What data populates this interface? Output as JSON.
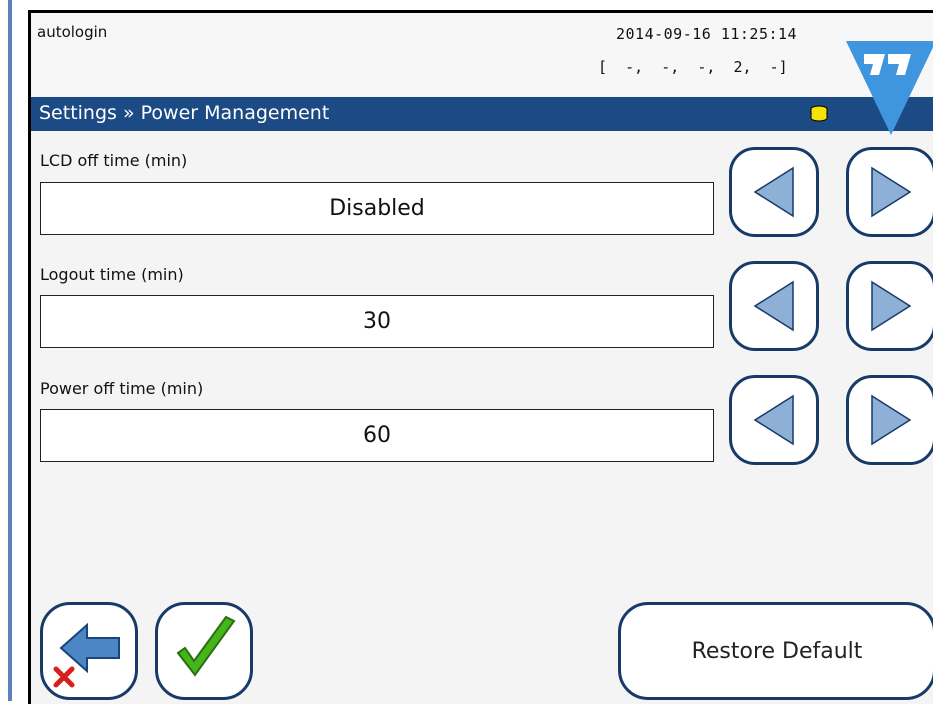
{
  "header": {
    "user": "autologin",
    "datetime": "2014-09-16 11:25:14",
    "status_codes": "[  -,  -,  -,  2,  -]",
    "title": "Settings » Power Management",
    "icons": [
      "database-icon",
      "logo-icon"
    ]
  },
  "settings": [
    {
      "label": "LCD off time (min)",
      "value": "Disabled"
    },
    {
      "label": "Logout time (min)",
      "value": "30"
    },
    {
      "label": "Power off time (min)",
      "value": "60"
    }
  ],
  "buttons": {
    "back": "back-cancel-button",
    "confirm": "confirm-button",
    "restore": "Restore Default"
  },
  "colors": {
    "titlebar": "#1c4a84",
    "button_border": "#173a68",
    "arrow_fill": "#8fb0d6",
    "confirm_green": "#44b51b",
    "cancel_red": "#d81f1f",
    "database_yellow": "#f5e400",
    "left_strip": "#5d82b8"
  }
}
